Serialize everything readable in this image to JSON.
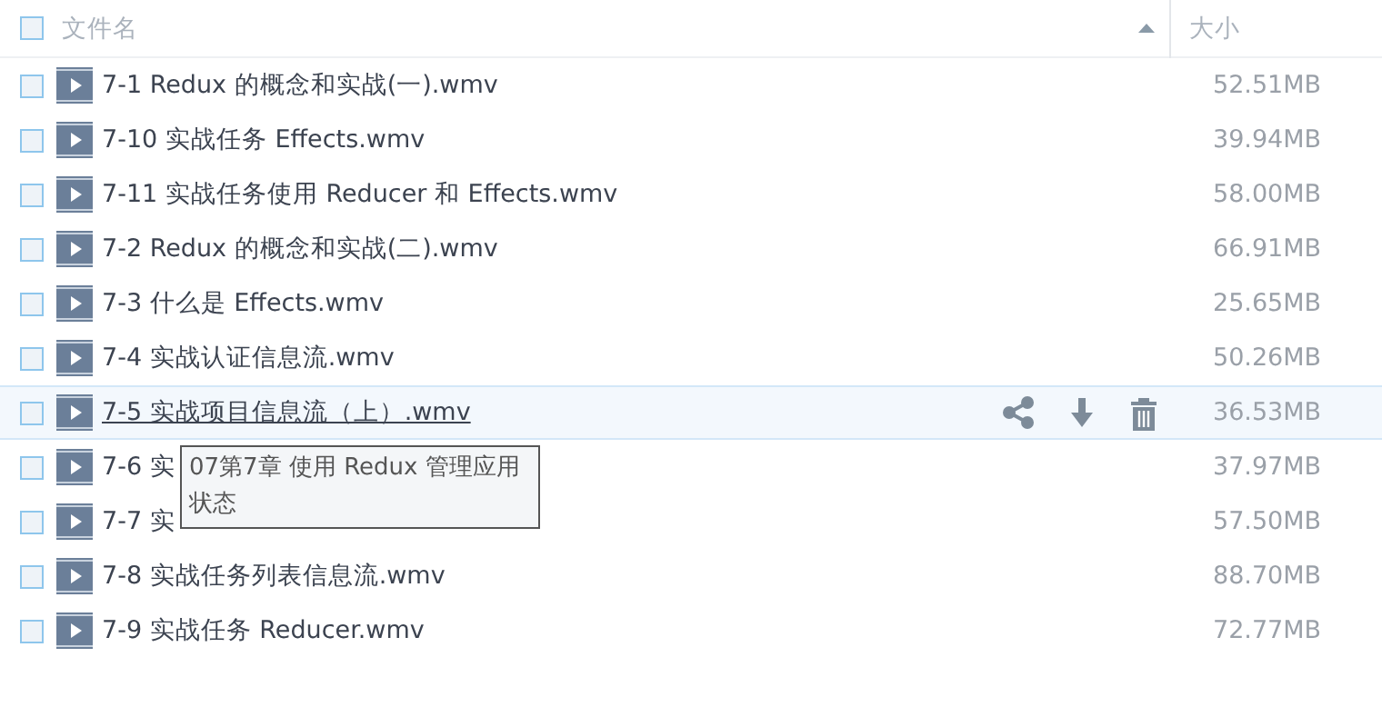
{
  "header": {
    "name_label": "文件名",
    "size_label": "大小",
    "select_all_checked": false
  },
  "rows": [
    {
      "name": "7-1 Redux 的概念和实战(一).wmv",
      "size": "52.51MB",
      "checked": false,
      "hovered": false
    },
    {
      "name": "7-10 实战任务 Effects.wmv",
      "size": "39.94MB",
      "checked": false,
      "hovered": false
    },
    {
      "name": "7-11 实战任务使用 Reducer 和 Effects.wmv",
      "size": "58.00MB",
      "checked": false,
      "hovered": false
    },
    {
      "name": "7-2 Redux 的概念和实战(二).wmv",
      "size": "66.91MB",
      "checked": false,
      "hovered": false
    },
    {
      "name": "7-3 什么是 Effects.wmv",
      "size": "25.65MB",
      "checked": false,
      "hovered": false
    },
    {
      "name": "7-4 实战认证信息流.wmv",
      "size": "50.26MB",
      "checked": false,
      "hovered": false
    },
    {
      "name": "7-5 实战项目信息流（上）.wmv",
      "size": "36.53MB",
      "checked": false,
      "hovered": true
    },
    {
      "name": "7-6 实",
      "size": "37.97MB",
      "checked": false,
      "hovered": false
    },
    {
      "name": "7-7 实",
      "size": "57.50MB",
      "checked": false,
      "hovered": false
    },
    {
      "name": "7-8 实战任务列表信息流.wmv",
      "size": "88.70MB",
      "checked": false,
      "hovered": false
    },
    {
      "name": "7-9 实战任务 Reducer.wmv",
      "size": "72.77MB",
      "checked": false,
      "hovered": false
    }
  ],
  "tooltip": "07第7章 使用 Redux 管理应用状态"
}
